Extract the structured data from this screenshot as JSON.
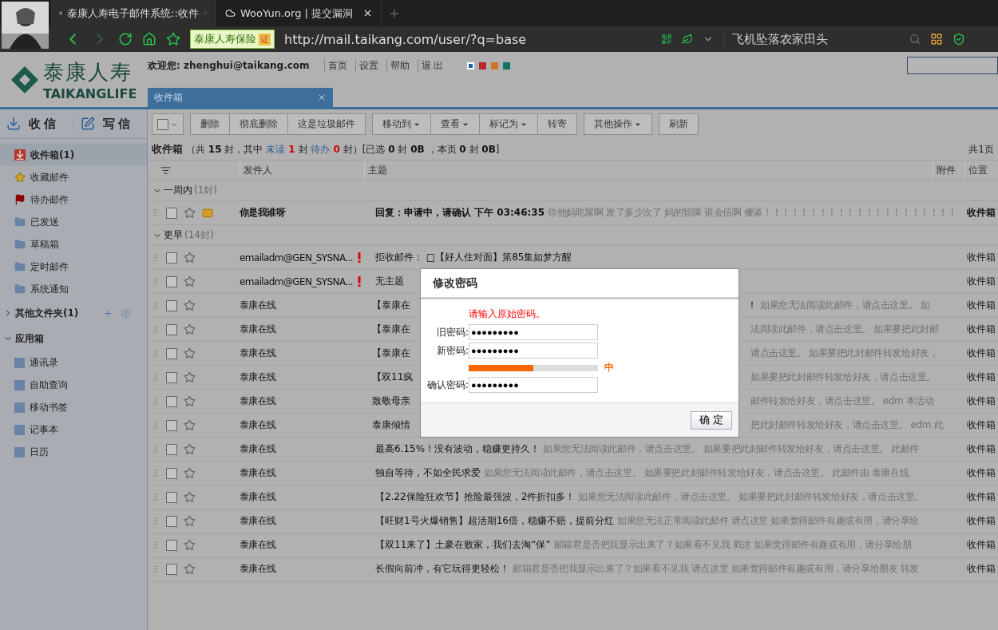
{
  "browser": {
    "tabs": [
      {
        "title": "泰康人寿电子邮件系统::收件",
        "selected": true
      },
      {
        "title": "WooYun.org | 提交漏洞",
        "selected": false
      }
    ],
    "site_badge": "泰康人寿保险",
    "cert_badge": "证",
    "url": "http://mail.taikang.com/user/?q=base",
    "search_value": "飞机坠落农家田头"
  },
  "header": {
    "logo_cn": "泰康人寿",
    "logo_en": "TAIKANGLIFE",
    "welcome": "欢迎您: zhenghui@taikang.com",
    "links": [
      "首页",
      "设置",
      "帮助",
      "退 出"
    ],
    "themes": [
      {
        "color": "#1f5fb5",
        "selected": true
      },
      {
        "color": "#b8262b",
        "selected": false
      },
      {
        "color": "#c9782a",
        "selected": false
      },
      {
        "color": "#0e7565",
        "selected": false
      }
    ]
  },
  "tabs": [
    {
      "label": "收件箱",
      "selected": true
    }
  ],
  "sidebar": {
    "actions": [
      {
        "label": "收信",
        "kind": "receive"
      },
      {
        "label": "写信",
        "kind": "compose"
      }
    ],
    "folders": [
      {
        "label": "收件箱(1)",
        "kind": "inbox",
        "selected": true
      },
      {
        "label": "收藏邮件",
        "kind": "starred",
        "selected": false
      },
      {
        "label": "待办邮件",
        "kind": "todo",
        "selected": false
      },
      {
        "label": "已发送",
        "kind": "folder",
        "selected": false
      },
      {
        "label": "草稿箱",
        "kind": "folder",
        "selected": false
      },
      {
        "label": "定时邮件",
        "kind": "folder",
        "selected": false
      },
      {
        "label": "系统通知",
        "kind": "folder",
        "selected": false
      }
    ],
    "other": {
      "label": "其他文件夹(1)",
      "expanded": false
    },
    "apps": {
      "label": "应用箱",
      "expanded": true,
      "items": [
        "通讯录",
        "自助查询",
        "移动书签",
        "记事本",
        "日历"
      ]
    }
  },
  "toolbar": {
    "select_all": {
      "checked": false
    },
    "groups": [
      [
        {
          "label": "删除",
          "dropdown": false
        },
        {
          "label": "彻底删除",
          "dropdown": false
        },
        {
          "label": "这是垃圾邮件",
          "dropdown": false
        }
      ],
      [
        {
          "label": "移动到",
          "dropdown": true
        },
        {
          "label": "查看",
          "dropdown": true
        },
        {
          "label": "标记为",
          "dropdown": true
        },
        {
          "label": "转寄",
          "dropdown": false
        }
      ],
      [
        {
          "label": "其他操作",
          "dropdown": true
        }
      ],
      [
        {
          "label": "刷新",
          "dropdown": false
        }
      ]
    ]
  },
  "summary": {
    "title": "收件箱",
    "parts": [
      {
        "text": "（共 ",
        "kind": "plain"
      },
      {
        "text": "15",
        "kind": "bold"
      },
      {
        "text": " 封，其中 ",
        "kind": "plain"
      },
      {
        "text": "未读",
        "kind": "link"
      },
      {
        "text": " 1",
        "kind": "alert"
      },
      {
        "text": " 封 ",
        "kind": "plain"
      },
      {
        "text": "待办",
        "kind": "link"
      },
      {
        "text": " 0",
        "kind": "alert"
      },
      {
        "text": " 封）[已选 ",
        "kind": "plain"
      },
      {
        "text": "0",
        "kind": "bold"
      },
      {
        "text": " 封 ",
        "kind": "plain"
      },
      {
        "text": "0B",
        "kind": "bold"
      },
      {
        "text": " ，本页 ",
        "kind": "plain"
      },
      {
        "text": "0",
        "kind": "bold"
      },
      {
        "text": " 封 ",
        "kind": "plain"
      },
      {
        "text": "0B",
        "kind": "bold"
      },
      {
        "text": "]",
        "kind": "plain"
      }
    ],
    "pages": "共1页"
  },
  "columns": [
    "发件人",
    "主题",
    "附件",
    "位置"
  ],
  "groups": [
    {
      "label": "一周内",
      "count": "(1封)",
      "expanded": true,
      "rows": [
        {
          "kind": "full",
          "sender": "你是我谁呀",
          "unread": true,
          "important": false,
          "checked": false,
          "starred": false,
          "subject": "回复：申请中，请确认 下午 03:46:35",
          "preview": "你他妈吃屎啊 发了多少次了 妈的智障 谁会信啊 傻逼！！！！！！！！！！！！！！！！！！！！！",
          "location": "收件箱"
        }
      ]
    },
    {
      "label": "更早",
      "count": "(14封)",
      "expanded": true,
      "rows": [
        {
          "kind": "full",
          "sender": "emailadm@GEN_SYSNA...",
          "unread": false,
          "important": true,
          "checked": false,
          "starred": false,
          "subject": "拒收邮件： □【好人住对面】第85集如梦方醒",
          "location": "收件箱"
        },
        {
          "kind": "full",
          "sender": "emailadm@GEN_SYSNA...",
          "unread": false,
          "important": true,
          "checked": false,
          "starred": false,
          "subject": "无主题",
          "location": "收件箱"
        },
        {
          "kind": "split",
          "sender": "泰康在线",
          "unread": false,
          "important": false,
          "checked": false,
          "starred": false,
          "subject": "【泰康在",
          "subject_rest": "！",
          "preview": "如果您无法阅读此邮件，请点击这里。 如",
          "location": "收件箱"
        },
        {
          "kind": "split",
          "sender": "泰康在线",
          "unread": false,
          "important": false,
          "checked": false,
          "starred": false,
          "subject": "【泰康在",
          "preview": "法阅读此邮件，请点击这里。 如果要把此封邮",
          "location": "收件箱"
        },
        {
          "kind": "split",
          "sender": "泰康在线",
          "unread": false,
          "important": false,
          "checked": false,
          "starred": false,
          "subject": "【泰康在",
          "preview": "请点击这里。 如果要把此封邮件转发给好友，",
          "location": "收件箱"
        },
        {
          "kind": "split",
          "sender": "泰康在线",
          "unread": false,
          "important": false,
          "checked": false,
          "starred": false,
          "subject": "【双11疯",
          "preview": "如果要把此封邮件转发给好友，请点击这里。",
          "location": "收件箱"
        },
        {
          "kind": "split",
          "sender": "泰康在线",
          "unread": false,
          "important": false,
          "checked": false,
          "starred": false,
          "subject": "致敬母亲",
          "preview": "邮件转发给好友，请点击这里。 edm 本活动",
          "location": "收件箱"
        },
        {
          "kind": "split",
          "sender": "泰康在线",
          "unread": false,
          "important": false,
          "checked": false,
          "starred": false,
          "subject": "泰康倾情",
          "preview": "把此封邮件转发给好友，请点击这里。 edm 此",
          "location": "收件箱"
        },
        {
          "kind": "full",
          "sender": "泰康在线",
          "unread": false,
          "important": false,
          "checked": false,
          "starred": false,
          "subject": "最高6.15%！没有波动，稳赚更持久！",
          "preview": "如果您无法阅读此邮件，请点击这里。 如果要把此封邮件转发给好友，请点击这里。 此邮件",
          "location": "收件箱"
        },
        {
          "kind": "full",
          "sender": "泰康在线",
          "unread": false,
          "important": false,
          "checked": false,
          "starred": false,
          "subject": "独自等待，不如全民求爱",
          "preview": "如果您无法阅读此邮件，请点击这里。 如果要把此封邮件转发给好友，请点击这里。 此邮件由 泰康在线",
          "location": "收件箱"
        },
        {
          "kind": "full",
          "sender": "泰康在线",
          "unread": false,
          "important": false,
          "checked": false,
          "starred": false,
          "subject": "【2.22保险狂欢节】抢险最强波，2件折扣多！",
          "preview": "如果您无法阅读此邮件，请点击这里。 如果要把此封邮件转发给好友，请点击这里。",
          "location": "收件箱"
        },
        {
          "kind": "full",
          "sender": "泰康在线",
          "unread": false,
          "important": false,
          "checked": false,
          "starred": false,
          "subject": "【旺财1号火爆销售】超活期16倍，稳赚不赔，提前分红",
          "preview": "如果您无法正常阅读此邮件 请点这里 如果觉得邮件有趣或有用，请分享给",
          "location": "收件箱"
        },
        {
          "kind": "full",
          "sender": "泰康在线",
          "unread": false,
          "important": false,
          "checked": false,
          "starred": false,
          "subject": "【双11来了】土豪在败家，我们去淘“保”",
          "preview": "邮箱君是否把我显示出来了？如果看不见我 戳这 如果觉得邮件有趣或有用，请分享给朋",
          "location": "收件箱"
        },
        {
          "kind": "full",
          "sender": "泰康在线",
          "unread": false,
          "important": false,
          "checked": false,
          "starred": false,
          "subject": "长假向前冲，有它玩得更轻松！",
          "preview": "邮箱君是否把我显示出来了？如果看不见我 请点这里 如果觉得邮件有趣或有用，请分享给朋友 转发",
          "location": "收件箱"
        }
      ]
    }
  ],
  "dialog": {
    "title": "修改密码",
    "error": "请输入原始密码。",
    "fields": [
      {
        "label": "旧密码:",
        "value": "●●●●●●●●●"
      },
      {
        "label": "新密码:",
        "value": "●●●●●●●●●",
        "strength": {
          "level": 0.5,
          "label": "中"
        }
      },
      {
        "label": "确认密码:",
        "value": "●●●●●●●●●"
      }
    ],
    "button": "确 定"
  }
}
